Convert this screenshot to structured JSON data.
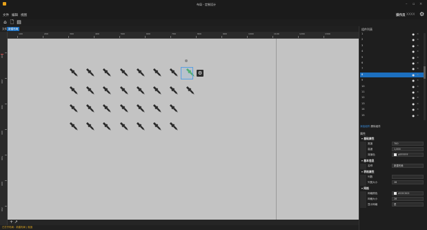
{
  "window": {
    "title": "布局 - 定制设计",
    "controls": [
      "–",
      "▫",
      "×"
    ]
  },
  "menu": {
    "items": [
      "文件",
      "编辑",
      "视图"
    ]
  },
  "user": {
    "label": "操作员",
    "name": "XXXX"
  },
  "toolbar": {
    "icons": [
      "home-icon",
      "new-file-icon",
      "save-icon"
    ]
  },
  "tabs": [
    {
      "label": "文件",
      "active": false
    },
    {
      "label": "新建布局",
      "active": true
    }
  ],
  "ruler": {
    "x_labels": [
      "100",
      "200",
      "300",
      "400",
      "500",
      "600",
      "700",
      "800",
      "900",
      "1000",
      "1100",
      "1200",
      "1300"
    ],
    "y_labels": [
      "100",
      "200",
      "300",
      "400",
      "500",
      "600",
      "700"
    ]
  },
  "grid": {
    "rows": [
      8,
      8,
      7,
      7
    ],
    "selected": {
      "row": 0,
      "col": 7
    }
  },
  "colors": {
    "accent": "#1c6fbf",
    "canvas": "#c3c3c3",
    "status": "#d9a321",
    "selected_tool": "#3aa84a"
  },
  "bottom": {
    "add_page": "+ ↗",
    "status": "已打开布局：新建布局 | 就绪"
  },
  "layers": {
    "title": "组件列表",
    "rows": [
      "1",
      "2",
      "3",
      "4",
      "5",
      "6",
      "7",
      "8",
      "9",
      "10",
      "11",
      "12",
      "13",
      "14",
      "15"
    ],
    "selected_index": 7,
    "actions": {
      "primary": "添加组件",
      "secondary": "删除组件"
    }
  },
  "properties": {
    "title": "属性",
    "sections": [
      {
        "name": "基础属性",
        "fields": [
          {
            "label": "宽度",
            "value": "700"
          },
          {
            "label": "高度",
            "value": "1,000"
          },
          {
            "label": "背景色",
            "value": "#FFFFFF",
            "swatch": true
          }
        ]
      },
      {
        "name": "基本信息",
        "fields": [
          {
            "label": "名称",
            "value": "新建布局"
          }
        ]
      },
      {
        "name": "表格属性",
        "fields": [
          {
            "label": "列数",
            "value": ""
          },
          {
            "label": "列宽大小",
            "value": "28"
          }
        ]
      },
      {
        "name": "网格",
        "fields": [
          {
            "label": "网格颜色",
            "value": "#C0C0C0",
            "swatch": true
          },
          {
            "label": "网格大小",
            "value": "28"
          },
          {
            "label": "显示网格",
            "value": "是"
          }
        ]
      }
    ]
  }
}
